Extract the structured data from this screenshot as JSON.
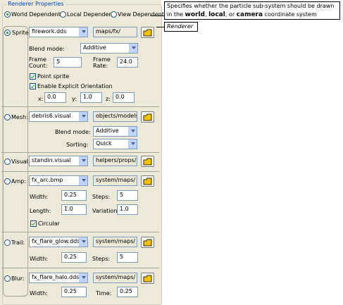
{
  "group": {
    "title": "Renderer Properties"
  },
  "coordinate_system": {
    "options": [
      "World Dependent",
      "Local Dependent",
      "View Dependent"
    ],
    "selected": "World Dependent"
  },
  "tooltip": {
    "line1": "Specifies whether the particle sub-system should be drawn",
    "in_the": "in the",
    "world": "world",
    "comma": ",",
    "local": "local",
    "or": ", or",
    "camera": "camera",
    "tail": "coordinate system"
  },
  "renderer_callout": "Renderer",
  "sprite": {
    "label": "Sprite",
    "file": "firework.dds",
    "path": "maps/fx/",
    "blend_mode_label": "Blend mode:",
    "blend_mode": "Additive",
    "frame_count_label_1": "Frame",
    "frame_count_label_2": "Count:",
    "frame_count": "5",
    "frame_rate_label_1": "Frame",
    "frame_rate_label_2": "Rate:",
    "frame_rate": "24.0",
    "point_sprite": "Point sprite",
    "explicit_orientation": "Enable Explicit Orientation",
    "x_label": "x:",
    "x": "0.0",
    "y_label": "y:",
    "y": "1.0",
    "z_label": "z:",
    "z": "0.0"
  },
  "mesh": {
    "label": "Mesh:",
    "file": "debris6.visual",
    "path": "objects/models/",
    "blend_mode_label": "Blend mode:",
    "blend_mode": "Additive",
    "sorting_label": "Sorting:",
    "sorting": "Quick"
  },
  "visual": {
    "label": "Visual:",
    "file": "standin.visual",
    "path": "helpers/props/"
  },
  "amp": {
    "label": "Amp:",
    "file": "fx_arc.bmp",
    "path": "system/maps/",
    "width_label": "Width:",
    "width": "0.25",
    "steps_label": "Steps:",
    "steps": "5",
    "length_label": "Length:",
    "length": "1.0",
    "variation_label": "Variation:",
    "variation": "1.0",
    "circular": "Circular"
  },
  "trail": {
    "label": "Trail:",
    "file": "fx_flare_glow.dds",
    "path": "system/maps/",
    "width_label": "Width:",
    "width": "0.25",
    "steps_label": "Steps:",
    "steps": "5"
  },
  "blur": {
    "label": "Blur:",
    "file": "fx_flare_halo.dds",
    "path": "system/maps/",
    "width_label": "Width:",
    "width": "0.25",
    "time_label": "Time:",
    "time": "0.25"
  },
  "colors": {
    "panel": "#ece9d8",
    "title": "#0046d5",
    "folder": "#f2c200"
  }
}
